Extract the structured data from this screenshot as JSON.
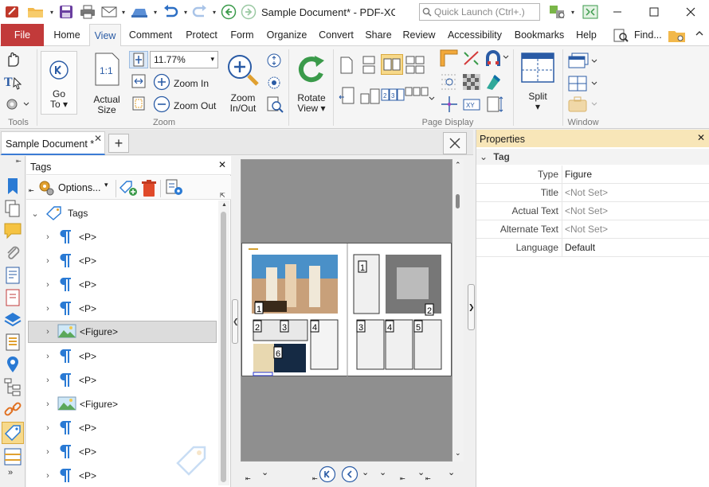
{
  "titlebar": {
    "document_title": "Sample Document* - PDF-XCh..",
    "quick_launch_placeholder": "Quick Launch (Ctrl+.)"
  },
  "ribbon_tabs": [
    "File",
    "Home",
    "View",
    "Comment",
    "Protect",
    "Form",
    "Organize",
    "Convert",
    "Share",
    "Review",
    "Accessibility",
    "Bookmarks",
    "Help"
  ],
  "ribbon_right": {
    "find_label": "Find..."
  },
  "ribbon": {
    "groups": {
      "tools": "Tools",
      "zoom": "Zoom",
      "page_display": "Page Display",
      "window": "Window"
    },
    "go_to": "Go\nTo",
    "go_to_line1": "Go",
    "go_to_line2": "To ▾",
    "actual_size_line1": "Actual",
    "actual_size_line2": "Size",
    "zoom_value": "11.77%",
    "zoom_in": "Zoom In",
    "zoom_out": "Zoom Out",
    "zoom_in_out_line1": "Zoom",
    "zoom_in_out_line2": "In/Out",
    "rotate_view_line1": "Rotate",
    "rotate_view_line2": "View ▾",
    "split_label": "Split",
    "split_arrow": "▾"
  },
  "doc_tabs": {
    "tab_label": "Sample Document *"
  },
  "tags_pane": {
    "title": "Tags",
    "options_label": "Options...",
    "root_label": "Tags",
    "items": [
      {
        "label": "<P>",
        "kind": "paragraph"
      },
      {
        "label": "<P>",
        "kind": "paragraph"
      },
      {
        "label": "<P>",
        "kind": "paragraph"
      },
      {
        "label": "<P>",
        "kind": "paragraph"
      },
      {
        "label": "<Figure>",
        "kind": "figure",
        "selected": true
      },
      {
        "label": "<P>",
        "kind": "paragraph"
      },
      {
        "label": "<P>",
        "kind": "paragraph"
      },
      {
        "label": "<Figure>",
        "kind": "figure"
      },
      {
        "label": "<P>",
        "kind": "paragraph"
      },
      {
        "label": "<P>",
        "kind": "paragraph"
      },
      {
        "label": "<P>",
        "kind": "paragraph"
      }
    ]
  },
  "page_preview": {
    "left_page_tags": [
      "1",
      "2",
      "3",
      "4",
      "6"
    ],
    "right_page_tags": [
      "1",
      "2",
      "3",
      "4",
      "5"
    ]
  },
  "properties": {
    "title": "Properties",
    "group": "Tag",
    "rows": [
      {
        "name": "Type",
        "value": "Figure",
        "muted": false
      },
      {
        "name": "Title",
        "value": "<Not Set>",
        "muted": true
      },
      {
        "name": "Actual Text",
        "value": "<Not Set>",
        "muted": true
      },
      {
        "name": "Alternate Text",
        "value": "<Not Set>",
        "muted": true
      },
      {
        "name": "Language",
        "value": "Default",
        "muted": false
      }
    ]
  },
  "colors": {
    "file_tab": "#c23a3a",
    "accent_blue": "#2a5ba5",
    "properties_header": "#f8e6b8"
  }
}
